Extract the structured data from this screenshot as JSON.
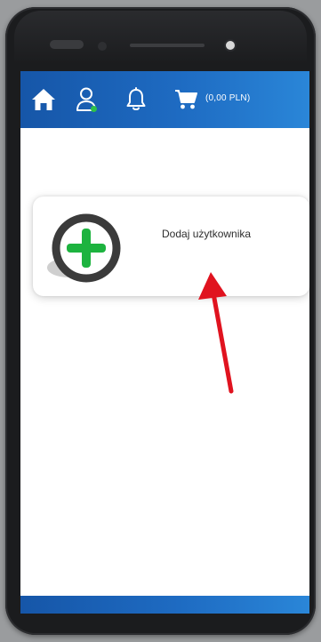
{
  "colors": {
    "topbar_gradient_start": "#1656a8",
    "topbar_gradient_end": "#2a86d8",
    "plus_green": "#1db33f",
    "ring_dark": "#3b3b3b",
    "annotation_red": "#e0131f",
    "online_dot": "#2ec04a"
  },
  "topbar": {
    "icons": [
      "home-icon",
      "user-icon",
      "bell-icon",
      "cart-icon"
    ],
    "cart_total": "(0,00 PLN)"
  },
  "card": {
    "icon": "plus-icon",
    "label": "Dodaj użytkownika"
  }
}
